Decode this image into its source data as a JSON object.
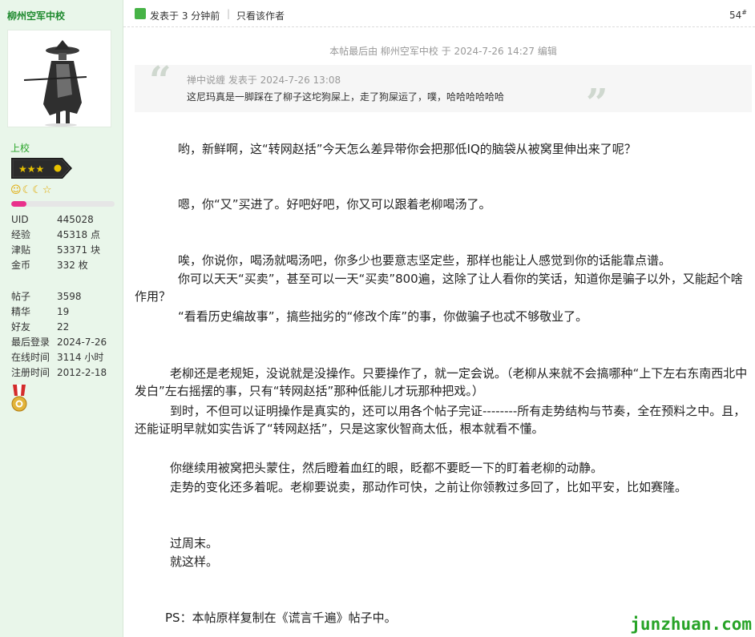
{
  "author": {
    "name": "柳州空军中校",
    "rank": "上校",
    "level_progress": 0.15,
    "stats": [
      {
        "key": "UID",
        "value": "445028"
      },
      {
        "key": "经验",
        "value": "45318 点"
      },
      {
        "key": "津贴",
        "value": "53371 块"
      },
      {
        "key": "金币",
        "value": "332 枚"
      }
    ],
    "stats2": [
      {
        "key": "帖子",
        "value": "3598"
      },
      {
        "key": "精华",
        "value": "19"
      },
      {
        "key": "好友",
        "value": "22"
      },
      {
        "key": "最后登录",
        "value": "2024-7-26"
      },
      {
        "key": "在线时间",
        "value": "3114 小时"
      },
      {
        "key": "注册时间",
        "value": "2012-2-18"
      }
    ]
  },
  "post": {
    "time": "发表于 3 分钟前",
    "divider": "|",
    "only_author": "只看该作者",
    "floor": "54",
    "floor_mark": "#",
    "edit_note": "本帖最后由 柳州空军中校 于 2024-7-26 14:27 编辑"
  },
  "quote": {
    "meta": "禅中说缠 发表于 2024-7-26 13:08",
    "text": "这尼玛真是一脚踩在了柳子这坨狗屎上，走了狗屎运了，噗，哈哈哈哈哈哈"
  },
  "paragraphs": [
    "　　哟，新鲜啊，这“转网赵括”今天怎么差异带你会把那低IQ的脑袋从被窝里伸出来了呢？",
    "　　嗯，你“又”买进了。好吧好吧，你又可以跟着老柳喝汤了。",
    "　　唉，你说你，喝汤就喝汤吧，你多少也要意志坚定些，那样也能让人感觉到你的话能靠点谱。",
    "　　你可以天天“买卖”，甚至可以一天“买卖”800遍，这除了让人看你的笑话，知道你是骗子以外，又能起个啥作用？",
    "　　“看看历史编故事”，搞些拙劣的“修改个库”的事，你做骗子也忒不够敬业了。",
    "　　老柳还是老规矩，没说就是没操作。只要操作了，就一定会说。（老柳从来就不会搞哪种“上下左右东南西北中发白”左右摇摆的事，只有“转网赵括”那种低能儿才玩那种把戏。）",
    "　　到时，不但可以证明操作是真实的，还可以用各个帖子完证--------所有走势结构与节奏，全在预料之中。且，还能证明早就如实告诉了“转网赵括”，只是这家伙智商太低，根本就看不懂。",
    "　　你继续用被窝把头蒙住，然后瞪着血红的眼，眨都不要眨一下的盯着老柳的动静。",
    "　　走势的变化还多着呢。老柳要说卖，那动作可快，之前让你领教过多回了，比如平安，比如赛隆。",
    "　　过周末。",
    "　　就这样。",
    "　　PS：本帖原样复制在《谎言千遍》帖子中。"
  ],
  "watermark": "junzhuan.com",
  "colors": {
    "sidebar_bg": "#e9f6ea",
    "author_green": "#1e8a2e",
    "rank_green": "#2aa52a",
    "progress_pink": "#e9308b",
    "watermark_green": "#27a327"
  }
}
